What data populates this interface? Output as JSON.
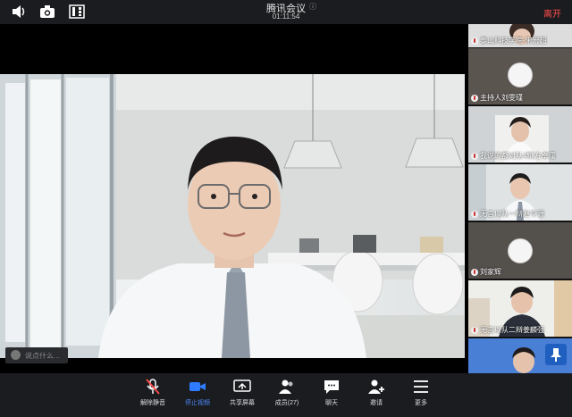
{
  "header": {
    "title": "腾讯会议",
    "elapsed": "01:11:54",
    "leave_label": "离开",
    "icons": [
      "speaker-icon",
      "camera-icon",
      "layout-icon",
      "info-icon"
    ]
  },
  "main": {
    "chat_placeholder": "说点什么..."
  },
  "participants": [
    {
      "label": "泰山科技学院-宋宏超"
    },
    {
      "label": "主持人刘雯瑾"
    },
    {
      "label": "我说的都对队4辩方卓瑾"
    },
    {
      "label": "无言以队一辩赵令源"
    },
    {
      "label": "刘家辉"
    },
    {
      "label": "无言以队二辩姜麟强"
    },
    {
      "label": ""
    }
  ],
  "toolbar": {
    "items": [
      {
        "label": "解除静音",
        "icon": "mic-muted-icon"
      },
      {
        "label": "停止视频",
        "icon": "video-icon"
      },
      {
        "label": "共享屏幕",
        "icon": "share-screen-icon"
      },
      {
        "label": "成员(27)",
        "icon": "members-icon"
      },
      {
        "label": "聊天",
        "icon": "chat-icon"
      },
      {
        "label": "邀请",
        "icon": "invite-icon"
      },
      {
        "label": "更多",
        "icon": "more-icon"
      }
    ]
  },
  "colors": {
    "accent": "#2f7bff",
    "leave": "#ff4d4d",
    "toolbar_bg": "#1b1c1f"
  }
}
